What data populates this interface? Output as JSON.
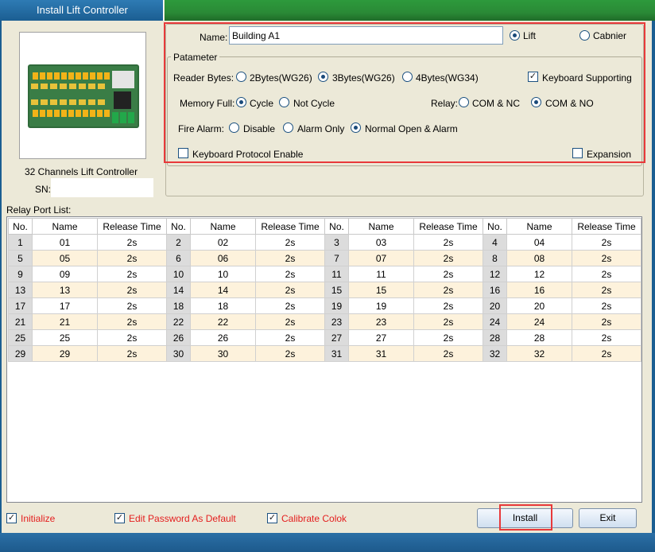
{
  "window": {
    "title": "Install Lift Controller"
  },
  "device": {
    "caption": "32 Channels Lift Controller",
    "sn_label": "SN:"
  },
  "config": {
    "name_label": "Name:",
    "name_value": "Building A1",
    "type_options": [
      {
        "label": "Lift",
        "selected": true
      },
      {
        "label": "Cabnier",
        "selected": false
      }
    ],
    "parameter_title": "Patameter",
    "reader_bytes_label": "Reader Bytes:",
    "reader_bytes_options": [
      {
        "label": "2Bytes(WG26)",
        "selected": false
      },
      {
        "label": "3Bytes(WG26)",
        "selected": true
      },
      {
        "label": "4Bytes(WG34)",
        "selected": false
      }
    ],
    "keyboard_supporting": {
      "label": "Keyboard Supporting",
      "checked": true
    },
    "memory_full_label": "Memory Full:",
    "memory_full_options": [
      {
        "label": "Cycle",
        "selected": true
      },
      {
        "label": "Not Cycle",
        "selected": false
      }
    ],
    "relay_label": "Relay:",
    "relay_options": [
      {
        "label": "COM & NC",
        "selected": false
      },
      {
        "label": "COM & NO",
        "selected": true
      }
    ],
    "fire_alarm_label": "Fire Alarm:",
    "fire_alarm_options": [
      {
        "label": "Disable",
        "selected": false
      },
      {
        "label": "Alarm Only",
        "selected": false
      },
      {
        "label": "Normal Open & Alarm",
        "selected": true
      }
    ],
    "keyboard_protocol": {
      "label": "Keyboard Protocol Enable",
      "checked": false
    },
    "expansion": {
      "label": "Expansion",
      "checked": false
    }
  },
  "relay_list": {
    "label": "Relay Port List:",
    "headers": [
      "No.",
      "Name",
      "Release Time"
    ],
    "rows": [
      [
        [
          "1",
          "01",
          "2s"
        ],
        [
          "2",
          "02",
          "2s"
        ],
        [
          "3",
          "03",
          "2s"
        ],
        [
          "4",
          "04",
          "2s"
        ]
      ],
      [
        [
          "5",
          "05",
          "2s"
        ],
        [
          "6",
          "06",
          "2s"
        ],
        [
          "7",
          "07",
          "2s"
        ],
        [
          "8",
          "08",
          "2s"
        ]
      ],
      [
        [
          "9",
          "09",
          "2s"
        ],
        [
          "10",
          "10",
          "2s"
        ],
        [
          "11",
          "11",
          "2s"
        ],
        [
          "12",
          "12",
          "2s"
        ]
      ],
      [
        [
          "13",
          "13",
          "2s"
        ],
        [
          "14",
          "14",
          "2s"
        ],
        [
          "15",
          "15",
          "2s"
        ],
        [
          "16",
          "16",
          "2s"
        ]
      ],
      [
        [
          "17",
          "17",
          "2s"
        ],
        [
          "18",
          "18",
          "2s"
        ],
        [
          "19",
          "19",
          "2s"
        ],
        [
          "20",
          "20",
          "2s"
        ]
      ],
      [
        [
          "21",
          "21",
          "2s"
        ],
        [
          "22",
          "22",
          "2s"
        ],
        [
          "23",
          "23",
          "2s"
        ],
        [
          "24",
          "24",
          "2s"
        ]
      ],
      [
        [
          "25",
          "25",
          "2s"
        ],
        [
          "26",
          "26",
          "2s"
        ],
        [
          "27",
          "27",
          "2s"
        ],
        [
          "28",
          "28",
          "2s"
        ]
      ],
      [
        [
          "29",
          "29",
          "2s"
        ],
        [
          "30",
          "30",
          "2s"
        ],
        [
          "31",
          "31",
          "2s"
        ],
        [
          "32",
          "32",
          "2s"
        ]
      ]
    ]
  },
  "options": {
    "initialize": {
      "label": "Initialize",
      "checked": true
    },
    "edit_password": {
      "label": "Edit Password As Default",
      "checked": true
    },
    "calibrate": {
      "label": "Calibrate Colok",
      "checked": true
    }
  },
  "buttons": {
    "install": "Install",
    "exit": "Exit"
  },
  "colors": {
    "accent_red": "#e41e1e",
    "title_blue": "#1b5e92",
    "title_green": "#2a8a36",
    "highlight": "#e8393a"
  }
}
